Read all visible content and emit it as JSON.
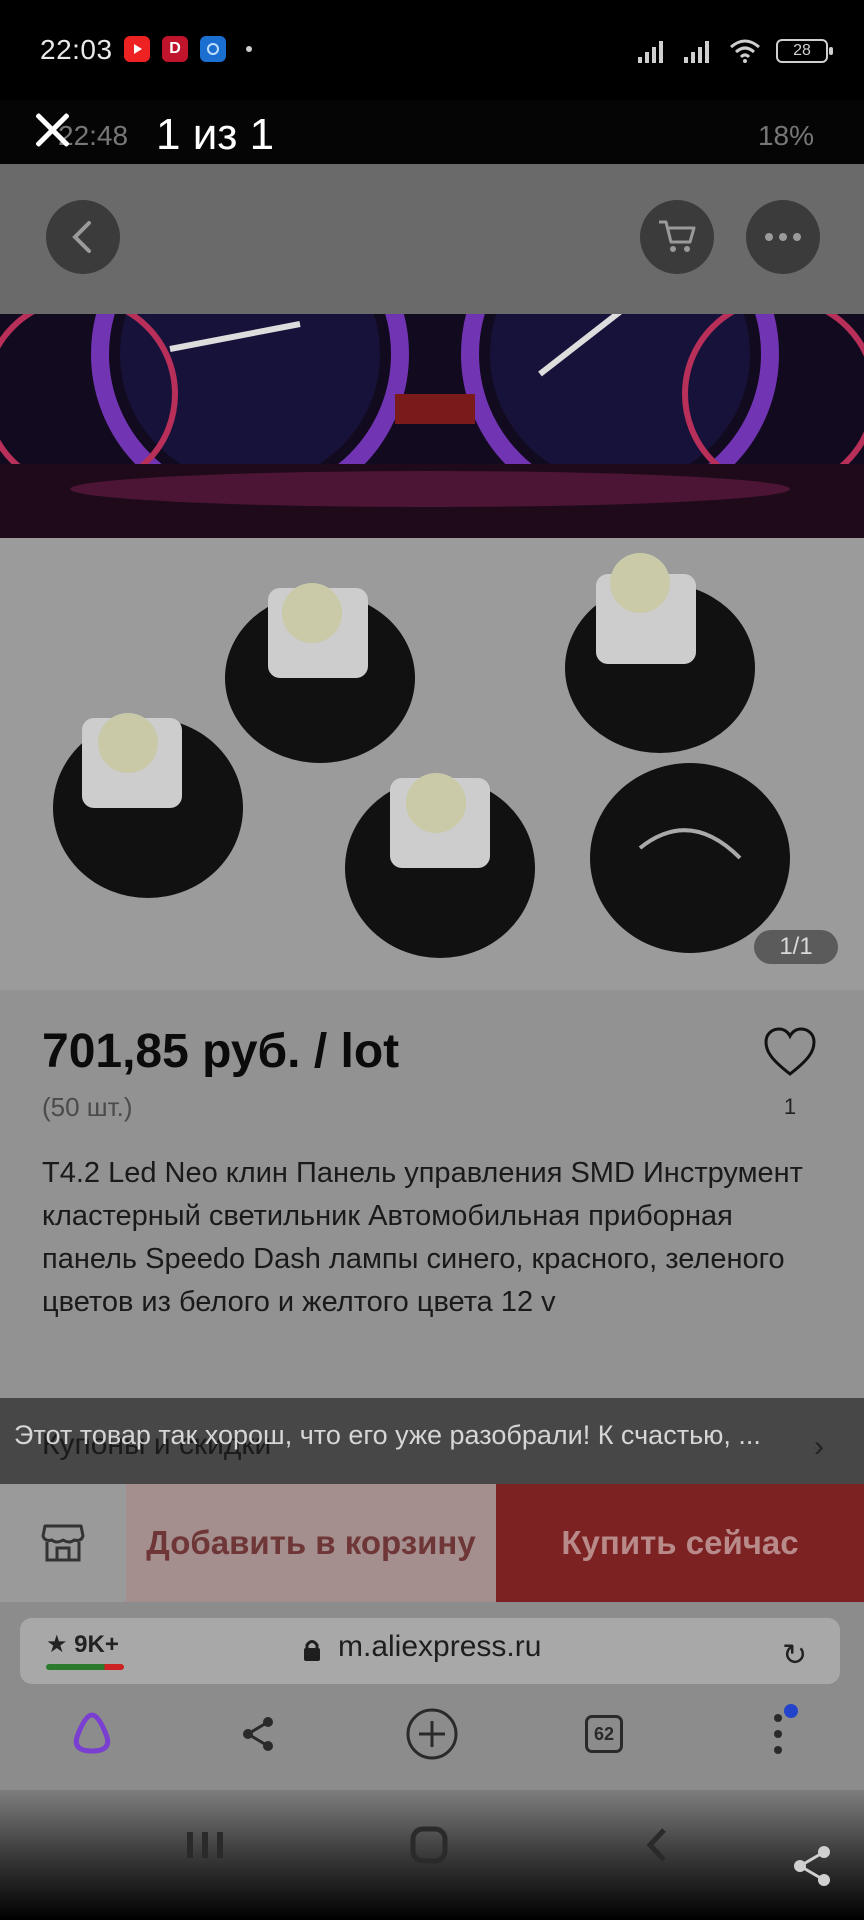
{
  "status_bar": {
    "time": "22:03",
    "apps": [
      "youtube-icon",
      "d-app-icon",
      "app-icon"
    ],
    "battery": "28"
  },
  "inner_status": {
    "time": "22:48",
    "right": "18%"
  },
  "viewer": {
    "counter": "1 из 1"
  },
  "product": {
    "image_counter": "1/1",
    "price": "701,85 руб. / lot",
    "quantity": "(50 шт.)",
    "wishlist_count": "1",
    "title": "T4.2 Led Neo клин Панель управления SMD Инструмент кластерный светильник Автомобильная приборная панель Speedo Dash лампы синего, красного, зеленого цветов из белого и желтого цвета 12 v"
  },
  "coupons": {
    "label": "Купоны и скидки",
    "toast": "Этот товар так хорош, что его уже разобрали! К счастью, ..."
  },
  "actions": {
    "add_to_cart": "Добавить в корзину",
    "buy_now": "Купить сейчас"
  },
  "browser": {
    "rating": "★ 9K+",
    "url": "m.aliexpress.ru",
    "tabs_count": "62"
  },
  "colors": {
    "accent_red": "#e43a3a",
    "browser_logo": "#7a3fd0",
    "notification_dot": "#2343c9"
  }
}
